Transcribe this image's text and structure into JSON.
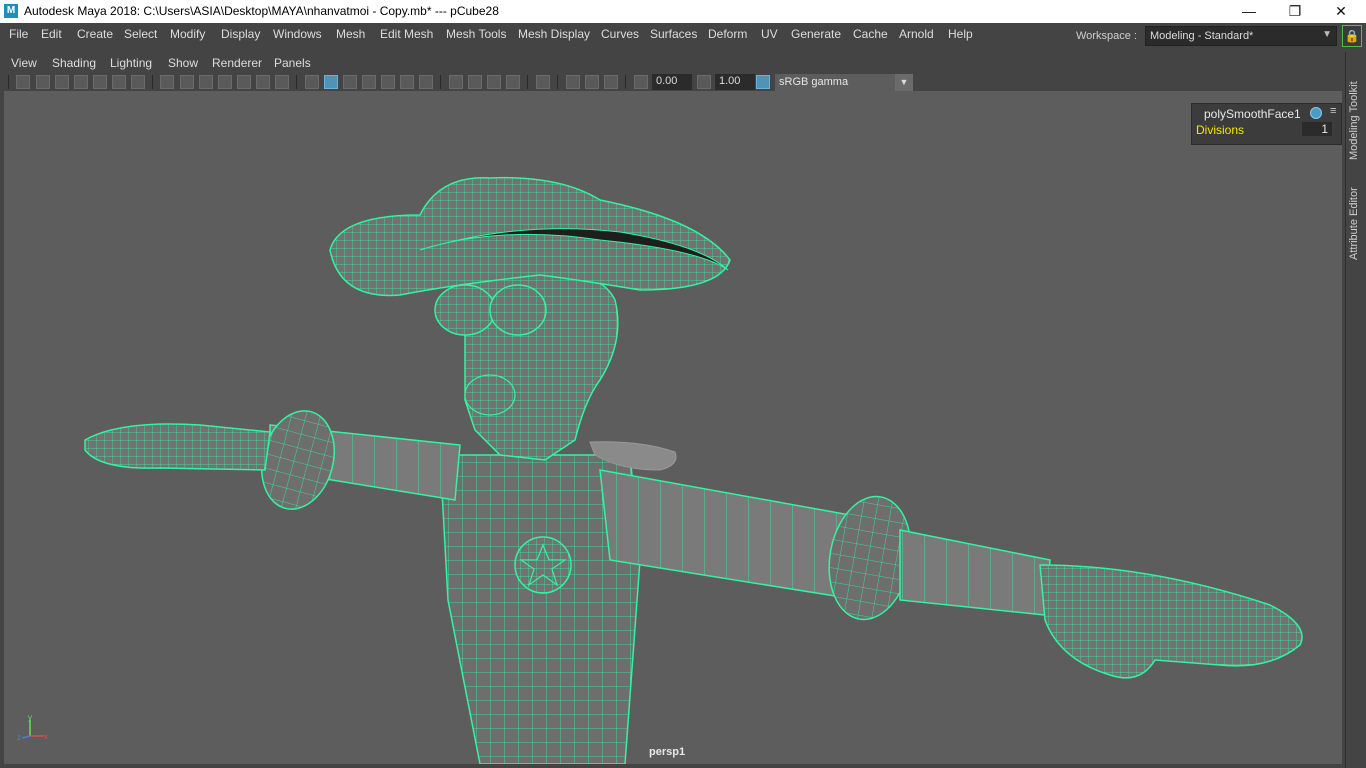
{
  "window": {
    "app_icon": "M",
    "title": "Autodesk Maya 2018: C:\\Users\\ASIA\\Desktop\\MAYA\\nhanvatmoi - Copy.mb*   ---   pCube28",
    "controls": [
      "minimize-icon",
      "restore-icon",
      "close-icon"
    ]
  },
  "menubar": {
    "items": [
      "File",
      "Edit",
      "Create",
      "Select",
      "Modify",
      "Display",
      "Windows",
      "Mesh",
      "Edit Mesh",
      "Mesh Tools",
      "Mesh Display",
      "Curves",
      "Surfaces",
      "Deform",
      "UV",
      "Generate",
      "Cache",
      "Arnold",
      "Help"
    ],
    "workspace_label": "Workspace :",
    "workspace_value": "Modeling - Standard*"
  },
  "panel": {
    "menu": [
      "View",
      "Shading",
      "Lighting",
      "Show",
      "Renderer",
      "Panels"
    ],
    "toolbar": {
      "exposure": "0.00",
      "gamma": "1.00",
      "color_space": "sRGB gamma"
    },
    "camera_label": "persp1"
  },
  "channel_box": {
    "node": "polySmoothFace1",
    "attribute": "Divisions",
    "value": "1"
  },
  "side_tabs": [
    "Modeling Toolkit",
    "Attribute Editor"
  ],
  "colors": {
    "wireframe": "#31f5a0",
    "viewport_bg": "#5d5d5d",
    "ui_bg": "#444444",
    "attribute_highlight": "#f5e600"
  }
}
